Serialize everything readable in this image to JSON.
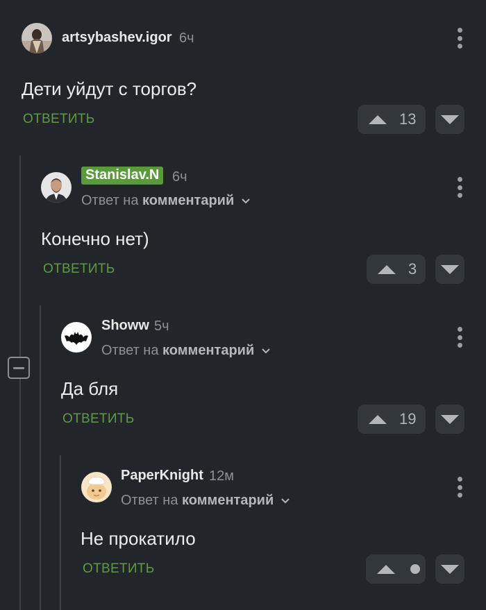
{
  "colors": {
    "background": "#22262b",
    "accent": "#5f9a45",
    "badge": "#5b9a3a",
    "button": "#32373c"
  },
  "comments": [
    {
      "username": "artsybashev.igor",
      "time": "6ч",
      "text": "Дети уйдут с торгов?",
      "reply_label": "ОТВЕТИТЬ",
      "votes": "13",
      "avatar_icon": "figure-avatar"
    },
    {
      "username": "Stanislav.N",
      "time": "6ч",
      "reply_prefix": "Ответ на",
      "reply_target": "комментарий",
      "text": "Конечно нет)",
      "reply_label": "ОТВЕТИТЬ",
      "votes": "3",
      "avatar_icon": "man-photo-avatar"
    },
    {
      "username": "Showw",
      "time": "5ч",
      "reply_prefix": "Ответ на",
      "reply_target": "комментарий",
      "text": "Да бля",
      "reply_label": "ОТВЕТИТЬ",
      "votes": "19",
      "avatar_icon": "batman-logo-avatar"
    },
    {
      "username": "PaperKnight",
      "time": "12м",
      "reply_prefix": "Ответ на",
      "reply_target": "комментарий",
      "text": "Не прокатило",
      "reply_label": "ОТВЕТИТЬ",
      "votes_icon": "hidden-rating-dot",
      "avatar_icon": "chef-avatar"
    }
  ]
}
